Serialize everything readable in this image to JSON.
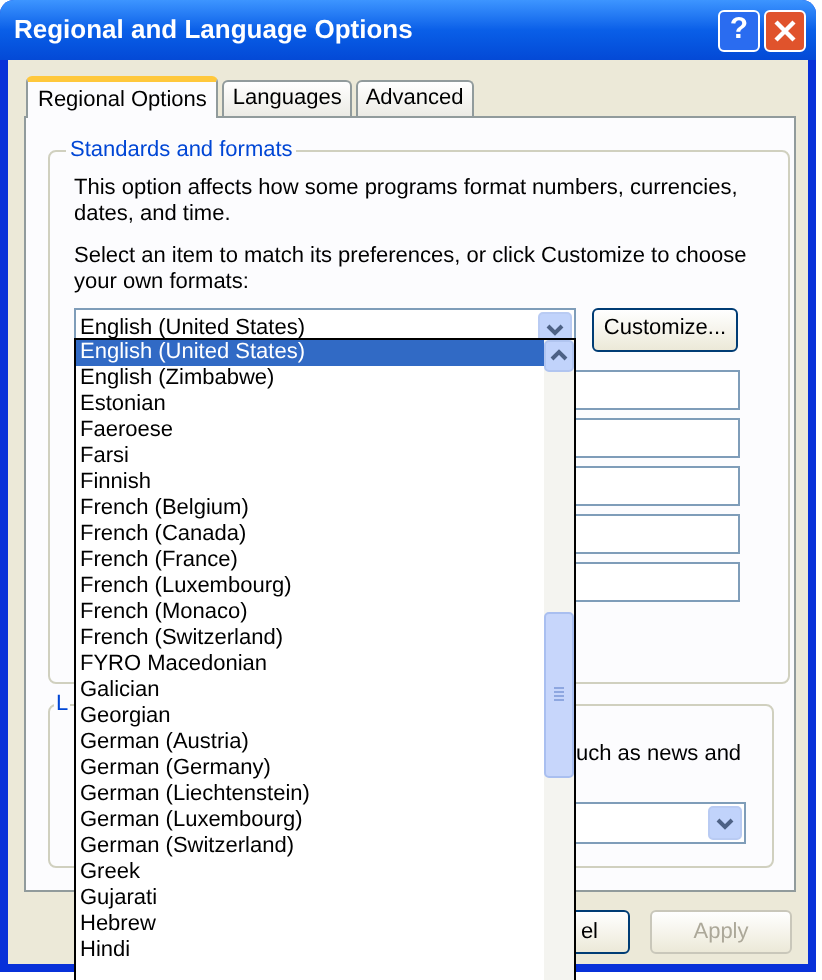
{
  "window": {
    "title": "Regional and Language Options",
    "help_button": "?"
  },
  "tabs": [
    {
      "label": "Regional Options",
      "selected": true
    },
    {
      "label": "Languages",
      "selected": false
    },
    {
      "label": "Advanced",
      "selected": false
    }
  ],
  "standards_group": {
    "title": "Standards and formats",
    "description": "This option affects how some programs format numbers, currencies, dates, and time.",
    "instruction": "Select an item to match its preferences, or click Customize to choose your own formats:",
    "format_combo": "English (United States)",
    "customize_button": "Customize..."
  },
  "format_list": [
    {
      "label": "English (United States)",
      "selected": true
    },
    {
      "label": "English (Zimbabwe)",
      "selected": false
    },
    {
      "label": "Estonian",
      "selected": false
    },
    {
      "label": "Faeroese",
      "selected": false
    },
    {
      "label": "Farsi",
      "selected": false
    },
    {
      "label": "Finnish",
      "selected": false
    },
    {
      "label": "French (Belgium)",
      "selected": false
    },
    {
      "label": "French (Canada)",
      "selected": false
    },
    {
      "label": "French (France)",
      "selected": false
    },
    {
      "label": "French (Luxembourg)",
      "selected": false
    },
    {
      "label": "French (Monaco)",
      "selected": false
    },
    {
      "label": "French (Switzerland)",
      "selected": false
    },
    {
      "label": "FYRO Macedonian",
      "selected": false
    },
    {
      "label": "Galician",
      "selected": false
    },
    {
      "label": "Georgian",
      "selected": false
    },
    {
      "label": "German (Austria)",
      "selected": false
    },
    {
      "label": "German (Germany)",
      "selected": false
    },
    {
      "label": "German (Liechtenstein)",
      "selected": false
    },
    {
      "label": "German (Luxembourg)",
      "selected": false
    },
    {
      "label": "German (Switzerland)",
      "selected": false
    },
    {
      "label": "Greek",
      "selected": false
    },
    {
      "label": "Gujarati",
      "selected": false
    },
    {
      "label": "Hebrew",
      "selected": false
    },
    {
      "label": "Hindi",
      "selected": false
    }
  ],
  "location_group": {
    "title": "L",
    "text": "uch as news and"
  },
  "buttons": [
    {
      "label": "el",
      "disabled": false
    },
    {
      "label": "Apply",
      "disabled": true
    }
  ]
}
